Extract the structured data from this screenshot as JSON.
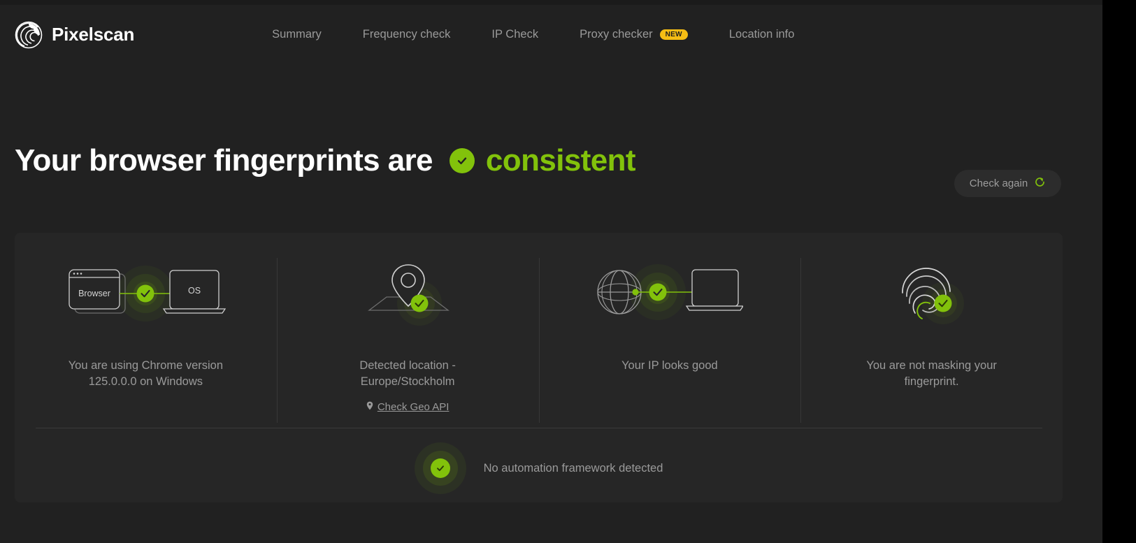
{
  "brand": {
    "name": "Pixelscan",
    "logo_icon": "spiral-logo-icon"
  },
  "nav": {
    "items": [
      {
        "label": "Summary",
        "badge": null
      },
      {
        "label": "Frequency check",
        "badge": null
      },
      {
        "label": "IP Check",
        "badge": null
      },
      {
        "label": "Proxy checker",
        "badge": "NEW"
      },
      {
        "label": "Location info",
        "badge": null
      }
    ]
  },
  "hero": {
    "title": "Your browser fingerprints are",
    "status": "consistent",
    "status_icon": "check-circle-icon",
    "check_again_label": "Check again",
    "check_again_icon": "refresh-icon"
  },
  "cards": [
    {
      "art": "browser-os-icon",
      "text": "You are using Chrome version 125.0.0.0 on Windows",
      "link": null,
      "link_icon": null
    },
    {
      "art": "map-pin-icon",
      "text": "Detected location - Europe/Stockholm",
      "link": "Check Geo API",
      "link_icon": "location-pin-icon"
    },
    {
      "art": "globe-laptop-icon",
      "text": "Your IP looks good",
      "link": null,
      "link_icon": null
    },
    {
      "art": "fingerprint-icon",
      "text": "You are not masking your fingerprint.",
      "link": null,
      "link_icon": null
    }
  ],
  "automation": {
    "text": "No automation framework detected",
    "icon": "check-circle-icon"
  },
  "colors": {
    "accent_green": "#82c20b",
    "badge_yellow": "#f5bd14",
    "page_bg": "#212121",
    "panel_bg": "#262626",
    "muted_text": "#9a9a9a"
  }
}
